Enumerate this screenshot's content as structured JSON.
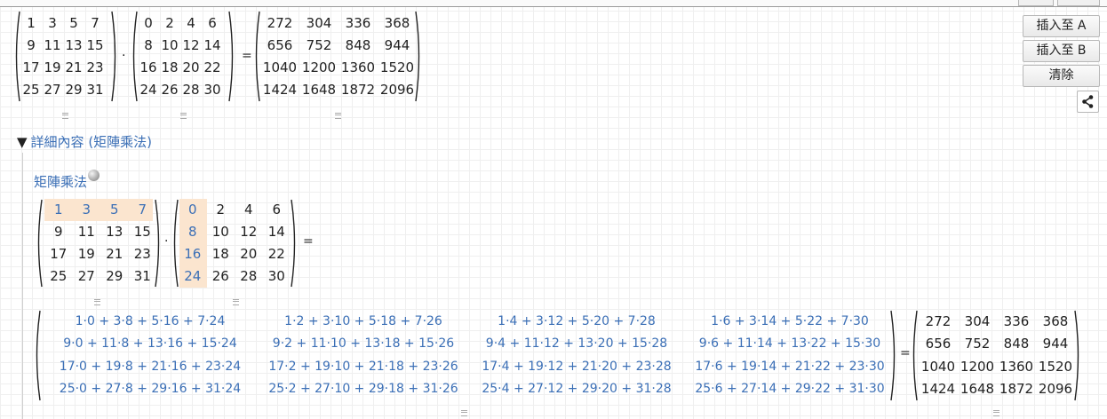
{
  "top": {
    "matrix_a": [
      [
        "1",
        "3",
        "5",
        "7"
      ],
      [
        "9",
        "11",
        "13",
        "15"
      ],
      [
        "17",
        "19",
        "21",
        "23"
      ],
      [
        "25",
        "27",
        "29",
        "31"
      ]
    ],
    "matrix_b": [
      [
        "0",
        "2",
        "4",
        "6"
      ],
      [
        "8",
        "10",
        "12",
        "14"
      ],
      [
        "16",
        "18",
        "20",
        "22"
      ],
      [
        "24",
        "26",
        "28",
        "30"
      ]
    ],
    "result": [
      [
        "272",
        "304",
        "336",
        "368"
      ],
      [
        "656",
        "752",
        "848",
        "944"
      ],
      [
        "1040",
        "1200",
        "1360",
        "1520"
      ],
      [
        "1424",
        "1648",
        "1872",
        "2096"
      ]
    ],
    "dot_symbol": "·",
    "equals_symbol": "="
  },
  "buttons": {
    "insert_a": "插入至 A",
    "insert_b": "插入至 B",
    "clear": "清除",
    "share_icon": "share-icon"
  },
  "details": {
    "toggle": "▼",
    "label": "詳細內容 (矩陣乘法)",
    "section_title": "矩陣乘法",
    "wiki_icon": "wikipedia-globe-icon",
    "matrix_a": [
      [
        "1",
        "3",
        "5",
        "7"
      ],
      [
        "9",
        "11",
        "13",
        "15"
      ],
      [
        "17",
        "19",
        "21",
        "23"
      ],
      [
        "25",
        "27",
        "29",
        "31"
      ]
    ],
    "matrix_b": [
      [
        "0",
        "2",
        "4",
        "6"
      ],
      [
        "8",
        "10",
        "12",
        "14"
      ],
      [
        "16",
        "18",
        "20",
        "22"
      ],
      [
        "24",
        "26",
        "28",
        "30"
      ]
    ],
    "expansion": [
      [
        "1·0 + 3·8 + 5·16 + 7·24",
        "1·2 + 3·10 + 5·18 + 7·26",
        "1·4 + 3·12 + 5·20 + 7·28",
        "1·6 + 3·14 + 5·22 + 7·30"
      ],
      [
        "9·0 + 11·8 + 13·16 + 15·24",
        "9·2 + 11·10 + 13·18 + 15·26",
        "9·4 + 11·12 + 13·20 + 15·28",
        "9·6 + 11·14 + 13·22 + 15·30"
      ],
      [
        "17·0 + 19·8 + 21·16 + 23·24",
        "17·2 + 19·10 + 21·18 + 23·26",
        "17·4 + 19·12 + 21·20 + 23·28",
        "17·6 + 19·14 + 21·22 + 23·30"
      ],
      [
        "25·0 + 27·8 + 29·16 + 31·24",
        "25·2 + 27·10 + 29·18 + 31·26",
        "25·4 + 27·12 + 29·20 + 31·28",
        "25·6 + 27·14 + 29·22 + 31·30"
      ]
    ],
    "result": [
      [
        "272",
        "304",
        "336",
        "368"
      ],
      [
        "656",
        "752",
        "848",
        "944"
      ],
      [
        "1040",
        "1200",
        "1360",
        "1520"
      ],
      [
        "1424",
        "1648",
        "1872",
        "2096"
      ]
    ]
  },
  "colors": {
    "link_blue": "#3b6fb6",
    "highlight": "#fbe5cf",
    "grid_line": "#efefef"
  }
}
